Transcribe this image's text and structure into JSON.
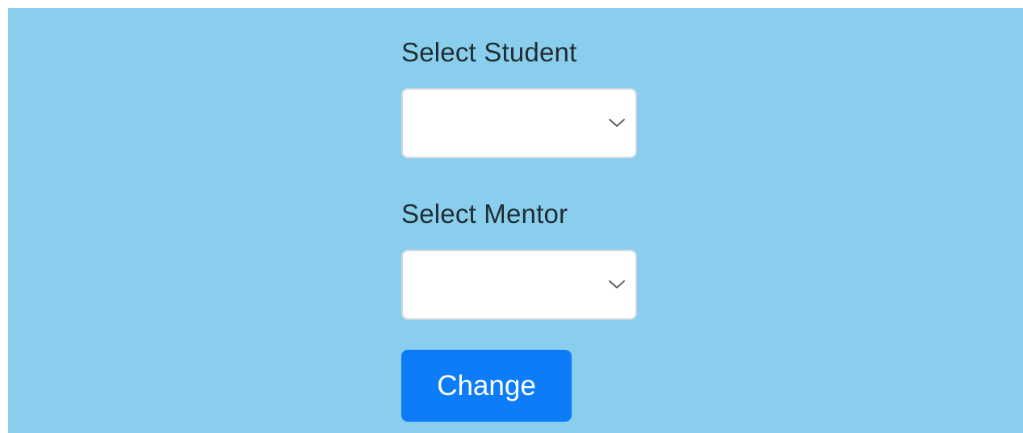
{
  "form": {
    "student": {
      "label": "Select Student",
      "selected_value": ""
    },
    "mentor": {
      "label": "Select Mentor",
      "selected_value": ""
    },
    "submit_label": "Change"
  },
  "icons": {
    "dropdown": "chevron-down-icon"
  },
  "colors": {
    "background": "#89ceed",
    "button": "#0d7cf9",
    "button_text": "#ffffff",
    "label_text": "#1f2d33"
  }
}
